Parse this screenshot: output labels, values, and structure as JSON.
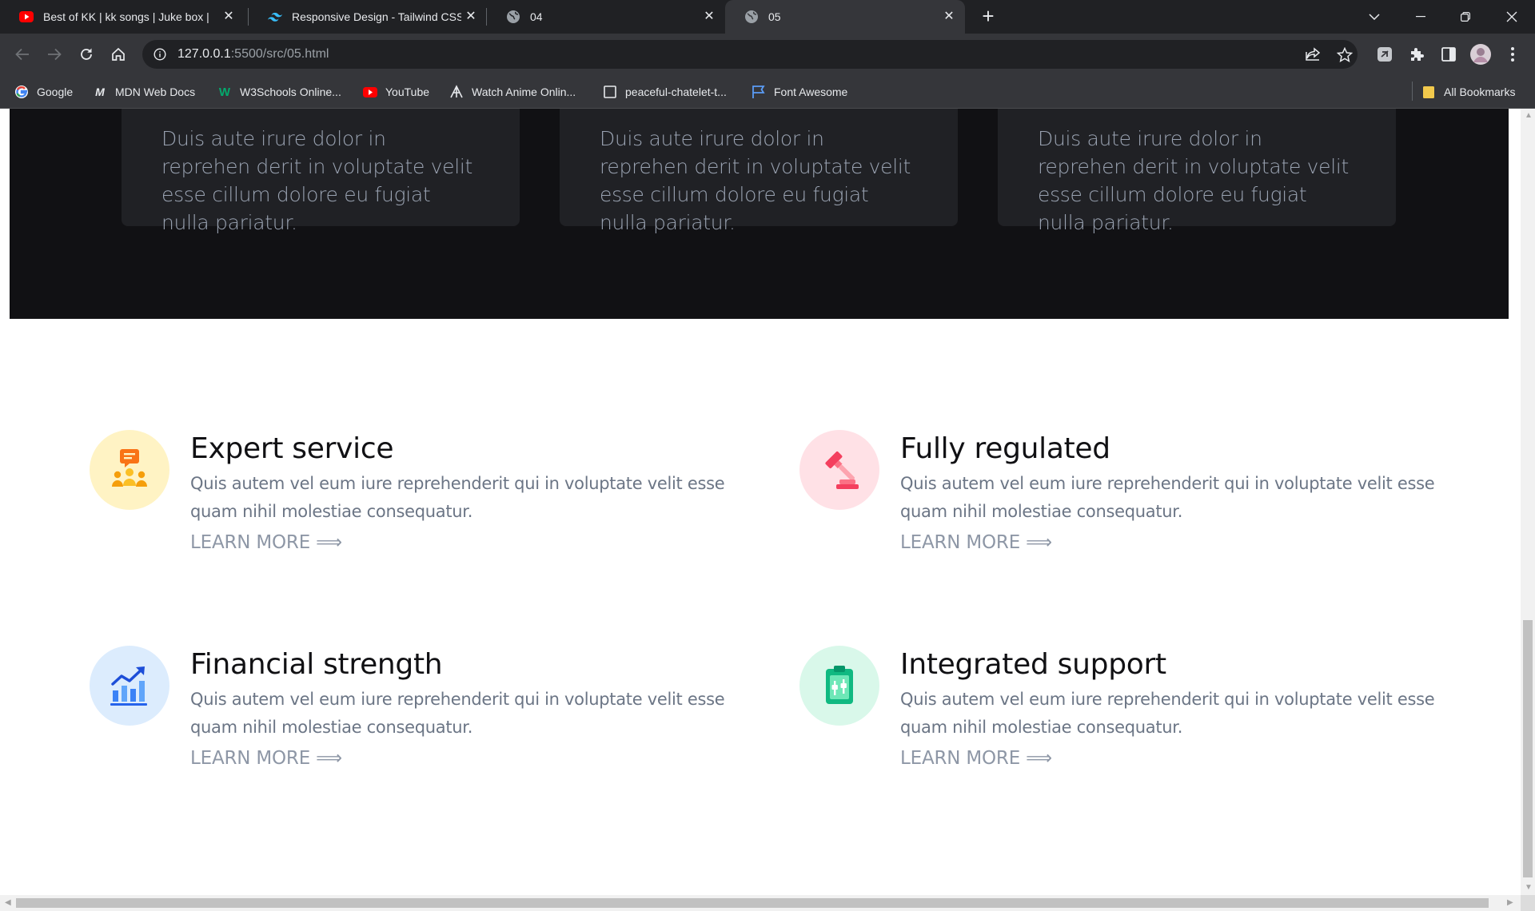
{
  "browser": {
    "tabs": [
      {
        "title": "Best of KK | kk songs | Juke box |",
        "favicon": "youtube-icon"
      },
      {
        "title": "Responsive Design - Tailwind CSS",
        "favicon": "tailwind-icon"
      },
      {
        "title": "04",
        "favicon": "globe-icon"
      },
      {
        "title": "05",
        "favicon": "globe-icon",
        "active": true
      }
    ],
    "url_host": "127.0.0.1",
    "url_rest": ":5500/src/05.html",
    "bookmarks": [
      {
        "label": "Google",
        "icon": "google-icon"
      },
      {
        "label": "MDN Web Docs",
        "icon": "mdn-icon"
      },
      {
        "label": "W3Schools Online...",
        "icon": "w3schools-icon"
      },
      {
        "label": "YouTube",
        "icon": "youtube-icon"
      },
      {
        "label": "Watch Anime Onlin...",
        "icon": "anime-icon"
      },
      {
        "label": "peaceful-chatelet-t...",
        "icon": "page-icon"
      },
      {
        "label": "Font Awesome",
        "icon": "flag-icon"
      }
    ],
    "all_bookmarks": "All Bookmarks",
    "colors": {
      "tabbar": "#202124",
      "toolbar": "#35363a"
    }
  },
  "page": {
    "dark_cards": [
      {
        "text": "Duis aute irure dolor in reprehen derit in voluptate velit esse cillum dolore eu fugiat nulla pariatur."
      },
      {
        "text": "Duis aute irure dolor in reprehen derit in voluptate velit esse cillum dolore eu fugiat nulla pariatur."
      },
      {
        "text": "Duis aute irure dolor in reprehen derit in voluptate velit esse cillum dolore eu fugiat nulla pariatur."
      }
    ],
    "features": [
      {
        "title": "Expert service",
        "desc": "Quis autem vel eum iure reprehenderit qui in voluptate velit esse quam nihil molestiae consequatur.",
        "link": "LEARN MORE ⟹",
        "icon": "support-team-icon",
        "bg": "#fff3c4"
      },
      {
        "title": "Fully regulated",
        "desc": "Quis autem vel eum iure reprehenderit qui in voluptate velit esse quam nihil molestiae consequatur.",
        "link": "LEARN MORE ⟹",
        "icon": "gavel-icon",
        "bg": "#ffe1e6"
      },
      {
        "title": "Financial strength",
        "desc": "Quis autem vel eum iure reprehenderit qui in voluptate velit esse quam nihil molestiae consequatur.",
        "link": "LEARN MORE ⟹",
        "icon": "growth-chart-icon",
        "bg": "#dcecfd"
      },
      {
        "title": "Integrated support",
        "desc": "Quis autem vel eum iure reprehenderit qui in voluptate velit esse quam nihil molestiae consequatur.",
        "link": "LEARN MORE ⟹",
        "icon": "clipboard-icon",
        "bg": "#d9f8ea"
      }
    ]
  }
}
